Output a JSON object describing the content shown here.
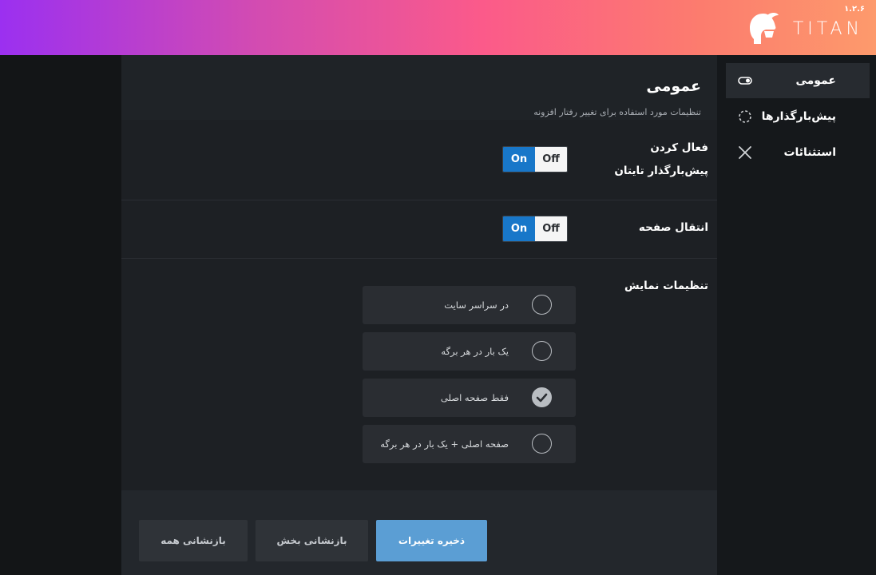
{
  "brand": {
    "name": "TITAN",
    "version": "۱.۲.۶"
  },
  "sidebar": {
    "items": [
      {
        "label": "عمومی",
        "icon": "toggle-icon"
      },
      {
        "label": "پیش‌بارگذارها",
        "icon": "loader-icon"
      },
      {
        "label": "استثنائات",
        "icon": "close-icon"
      }
    ]
  },
  "main": {
    "title": "عمومی",
    "subtitle": "تنظیمات مورد استفاده برای تغییر رفتار افزونه",
    "rows": [
      {
        "label_line1": "فعال کردن",
        "label_line2": "پیش‌بارگذار تایتان",
        "on": "On",
        "off": "Off",
        "state": "on"
      },
      {
        "label": "انتقال صفحه",
        "on": "On",
        "off": "Off",
        "state": "on"
      }
    ],
    "display_settings": {
      "label": "تنظیمات نمایش",
      "options": [
        {
          "label": "در سراسر سایت",
          "checked": false
        },
        {
          "label": "یک بار در هر برگه",
          "checked": false
        },
        {
          "label": "فقط صفحه اصلی",
          "checked": true
        },
        {
          "label": "صفحه اصلی + یک بار در هر برگه",
          "checked": false
        }
      ]
    }
  },
  "footer": {
    "save": "ذخیره تغییرات",
    "reset_section": "بازنشانی بخش",
    "reset_all": "بازنشانی همه"
  },
  "colors": {
    "accent": "#1877c9",
    "save_button": "#5b9ed4",
    "gradient_start": "#9b30f0",
    "gradient_end": "#fd9a6c"
  }
}
